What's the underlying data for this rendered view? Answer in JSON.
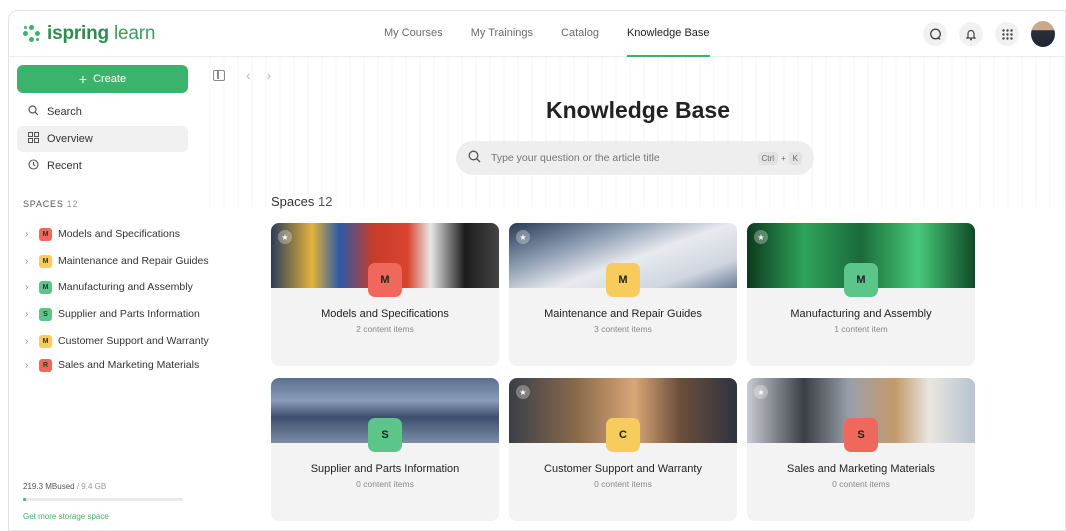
{
  "header": {
    "logo_text": "ispring",
    "logo_text_2": "learn",
    "nav": [
      {
        "label": "My Courses",
        "active": false
      },
      {
        "label": "My Trainings",
        "active": false
      },
      {
        "label": "Catalog",
        "active": false
      },
      {
        "label": "Knowledge Base",
        "active": true
      }
    ]
  },
  "sidebar": {
    "create_label": "Create",
    "search_label": "Search",
    "overview_label": "Overview",
    "recent_label": "Recent",
    "spaces_title": "SPACES",
    "spaces_count": "12",
    "spaces": [
      {
        "letter": "M",
        "label": "Models and Specifications",
        "color": "#f0685c"
      },
      {
        "letter": "M",
        "label": "Maintenance and Repair Guides",
        "color": "#f7cb5c"
      },
      {
        "letter": "M",
        "label": "Manufacturing and Assembly",
        "color": "#5cc58a"
      },
      {
        "letter": "S",
        "label": "Supplier and Parts Information",
        "color": "#5cc58a"
      },
      {
        "letter": "M",
        "label": "Customer Support and Warranty",
        "color": "#f7cb5c"
      },
      {
        "letter": "R",
        "label": "Sales and Marketing Materials",
        "color": "#f0685c"
      }
    ],
    "storage_used": "219.3 MBused",
    "storage_total": "/ 9.4 GB",
    "storage_fraction": 0.023,
    "storage_link": "Get more storage space"
  },
  "main": {
    "title": "Knowledge Base",
    "search_placeholder": "Type your question or the article title",
    "kbd_ctrl": "Ctrl",
    "kbd_plus": "+",
    "kbd_k": "K",
    "spaces_label": "Spaces",
    "spaces_count": "12",
    "cards": [
      {
        "letter": "M",
        "title": "Models and Specifications",
        "sub": "2 content items",
        "badge_color": "#f0685c",
        "image": "colorful-cars"
      },
      {
        "letter": "M",
        "title": "Maintenance and Repair Guides",
        "sub": "3 content items",
        "badge_color": "#f7cb5c",
        "image": "documents-pen"
      },
      {
        "letter": "M",
        "title": "Manufacturing and Assembly",
        "sub": "1 content item",
        "badge_color": "#5cc58a",
        "image": "green-factory"
      },
      {
        "letter": "S",
        "title": "Supplier and Parts Information",
        "sub": "0 content items",
        "badge_color": "#5cc58a",
        "image": "trucks-warehouse"
      },
      {
        "letter": "C",
        "title": "Customer Support and Warranty",
        "sub": "0 content items",
        "badge_color": "#f7cb5c",
        "image": "support-headset"
      },
      {
        "letter": "S",
        "title": "Sales and Marketing Materials",
        "sub": "0 content items",
        "badge_color": "#f0685c",
        "image": "car-showroom"
      }
    ]
  },
  "colors": {
    "accent": "#3cb36b"
  }
}
